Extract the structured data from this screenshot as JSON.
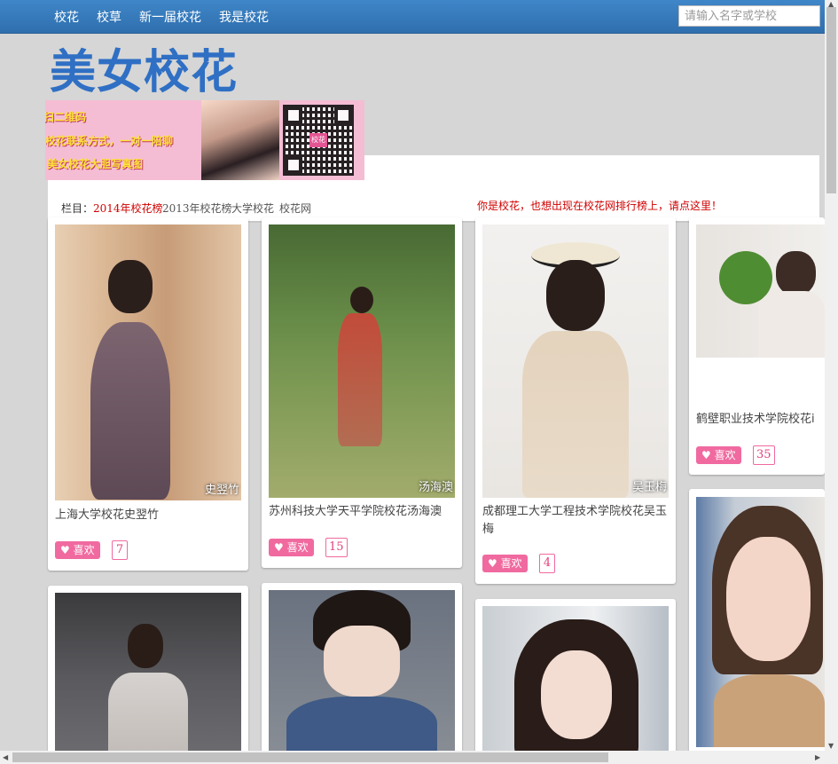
{
  "nav": {
    "items": [
      "校花",
      "校草",
      "新一届校花",
      "我是校花"
    ],
    "search_placeholder": "请输入名字或学校"
  },
  "logo": {
    "text": "美女校花"
  },
  "banner": {
    "lines": [
      "扫二维码",
      "校花联系方式，一对一陪聊",
      "美女校花大胆写真图"
    ],
    "qr_badge": "校花"
  },
  "category": {
    "label": "栏目：",
    "links": [
      "2014年校花榜",
      "2013年校花榜",
      "大学校花",
      "校花网"
    ],
    "notice": "你是校花，也想出现在校花网排行榜上，请点这里！"
  },
  "like_label": "喜欢",
  "cards": [
    {
      "name_tag": "史翌竹",
      "title": "上海大学校花史翌竹",
      "likes": "7"
    },
    {
      "name_tag": "汤海澳",
      "title": "苏州科技大学天平学院校花汤海澳",
      "likes": "15"
    },
    {
      "name_tag": "吴玉梅",
      "title": "成都理工大学工程技术学院校花吴玉梅",
      "likes": "4"
    },
    {
      "name_tag": "",
      "title": "鹤壁职业技术学院校花i",
      "likes": "35"
    },
    {
      "name_tag": "",
      "title": "",
      "likes": ""
    },
    {
      "name_tag": "",
      "title": "",
      "likes": ""
    },
    {
      "name_tag": "",
      "title": "",
      "likes": ""
    },
    {
      "name_tag": "",
      "title": "",
      "likes": ""
    }
  ]
}
